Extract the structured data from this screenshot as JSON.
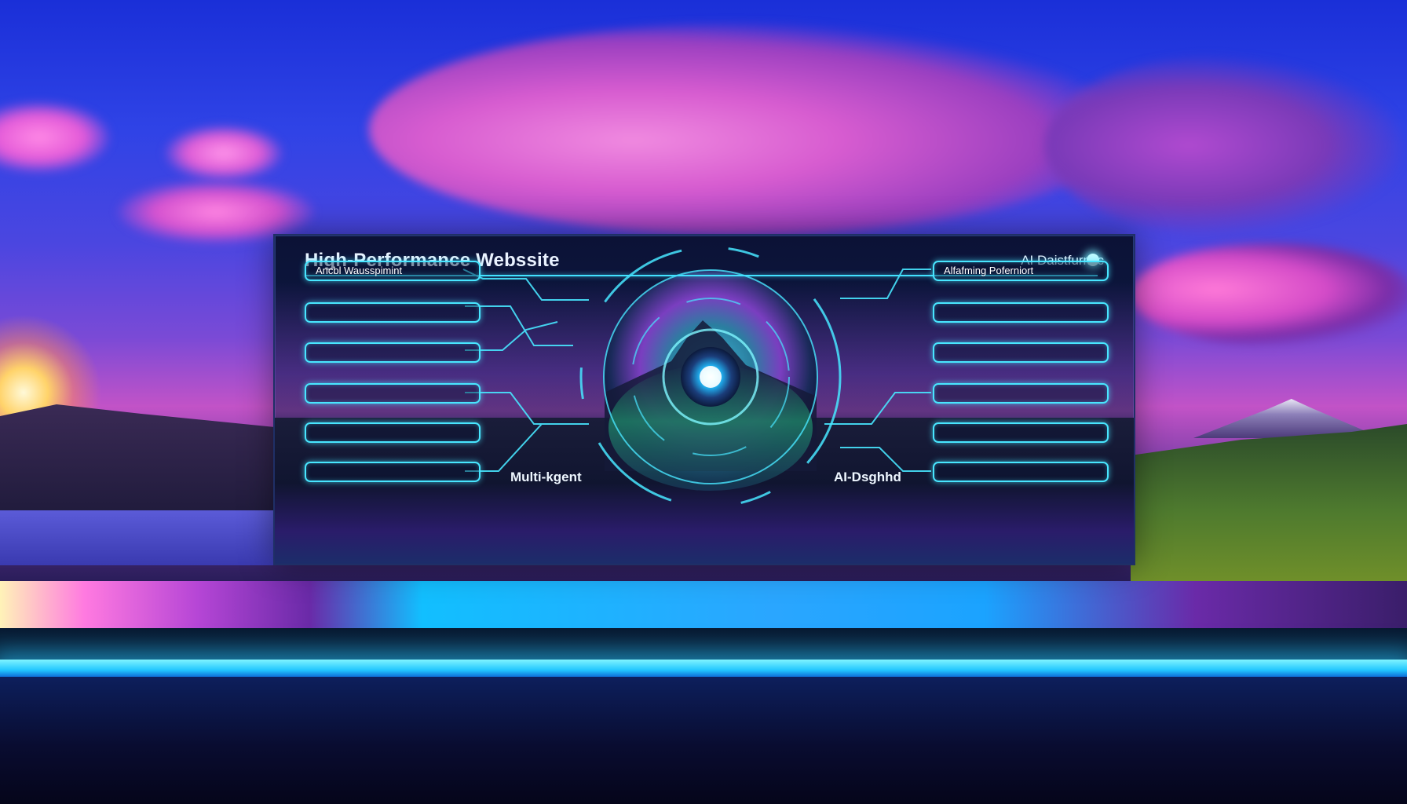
{
  "panel": {
    "title": "High-Performance Webssite",
    "status_label": "AI Daistfurmic",
    "left_features": [
      "Ancbl Wausspimint",
      "",
      "",
      "",
      "",
      ""
    ],
    "right_features": [
      "Alfafming Poferniort",
      "",
      "",
      "",
      "",
      ""
    ],
    "caption_left": "Multi-kgent",
    "caption_right": "AI-Dsghhd"
  },
  "colors": {
    "accent_neon": "#48e6ff",
    "sky_blue": "#2f43e6",
    "cloud_pink": "#e25ac8",
    "neon_strip": "#23c8ff"
  },
  "icons": {
    "status": "status-dot-icon",
    "hub": "holographic-globe-icon"
  }
}
